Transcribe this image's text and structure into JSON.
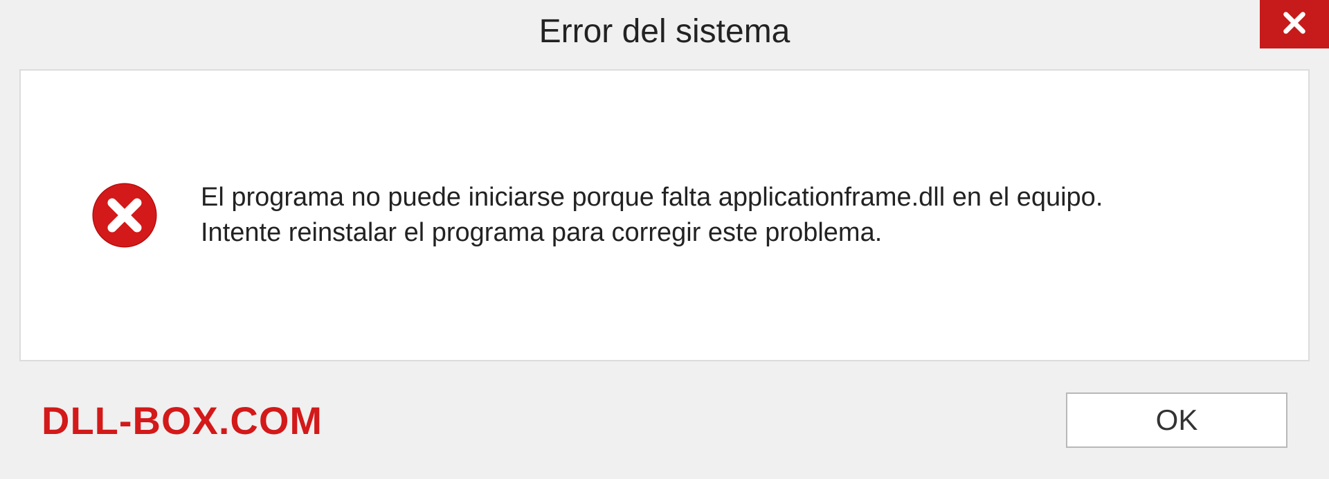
{
  "dialog": {
    "title": "Error del sistema",
    "message": "El programa no puede iniciarse porque falta applicationframe.dll en el equipo. Intente reinstalar el programa para corregir este problema.",
    "ok_label": "OK"
  },
  "watermark": "DLL-BOX.COM",
  "colors": {
    "error_red": "#c71a1a",
    "watermark_red": "#d31919"
  }
}
